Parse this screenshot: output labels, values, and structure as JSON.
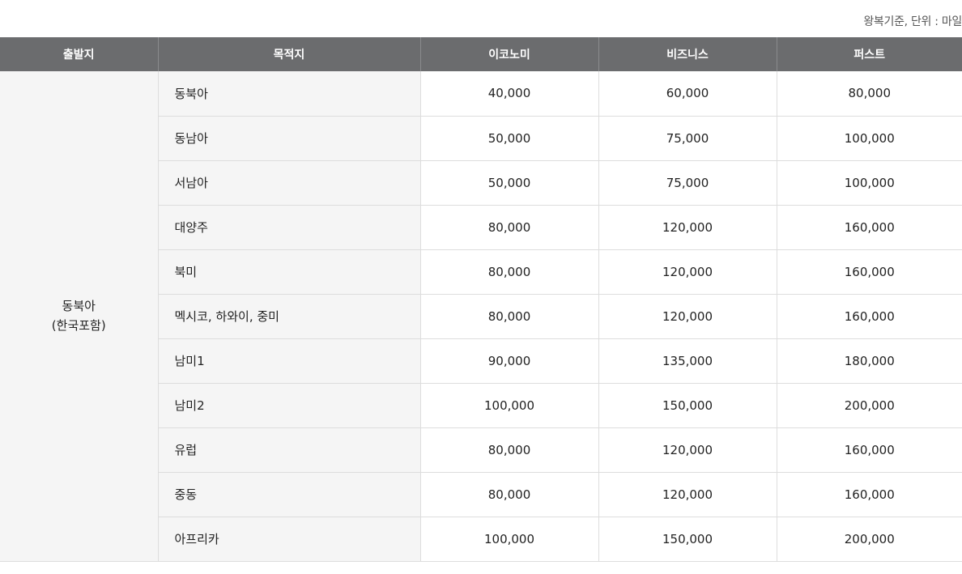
{
  "unit_note": "왕복기준, 단위 : 마일",
  "table": {
    "headers": [
      "출발지",
      "목적지",
      "이코노미",
      "비즈니스",
      "퍼스트"
    ],
    "origin": {
      "line1": "동북아",
      "line2": "(한국포함)"
    },
    "rows": [
      {
        "destination": "동북아",
        "economy": "40,000",
        "business": "60,000",
        "first": "80,000"
      },
      {
        "destination": "동남아",
        "economy": "50,000",
        "business": "75,000",
        "first": "100,000"
      },
      {
        "destination": "서남아",
        "economy": "50,000",
        "business": "75,000",
        "first": "100,000"
      },
      {
        "destination": "대양주",
        "economy": "80,000",
        "business": "120,000",
        "first": "160,000"
      },
      {
        "destination": "북미",
        "economy": "80,000",
        "business": "120,000",
        "first": "160,000"
      },
      {
        "destination": "멕시코, 하와이, 중미",
        "economy": "80,000",
        "business": "120,000",
        "first": "160,000"
      },
      {
        "destination": "남미1",
        "economy": "90,000",
        "business": "135,000",
        "first": "180,000"
      },
      {
        "destination": "남미2",
        "economy": "100,000",
        "business": "150,000",
        "first": "200,000"
      },
      {
        "destination": "유럽",
        "economy": "80,000",
        "business": "120,000",
        "first": "160,000"
      },
      {
        "destination": "중동",
        "economy": "80,000",
        "business": "120,000",
        "first": "160,000"
      },
      {
        "destination": "아프리카",
        "economy": "100,000",
        "business": "150,000",
        "first": "200,000"
      }
    ]
  },
  "colors": {
    "header_bg": "#6b6c6e",
    "label_cell_bg": "#f5f5f5",
    "border": "#dddddd"
  }
}
